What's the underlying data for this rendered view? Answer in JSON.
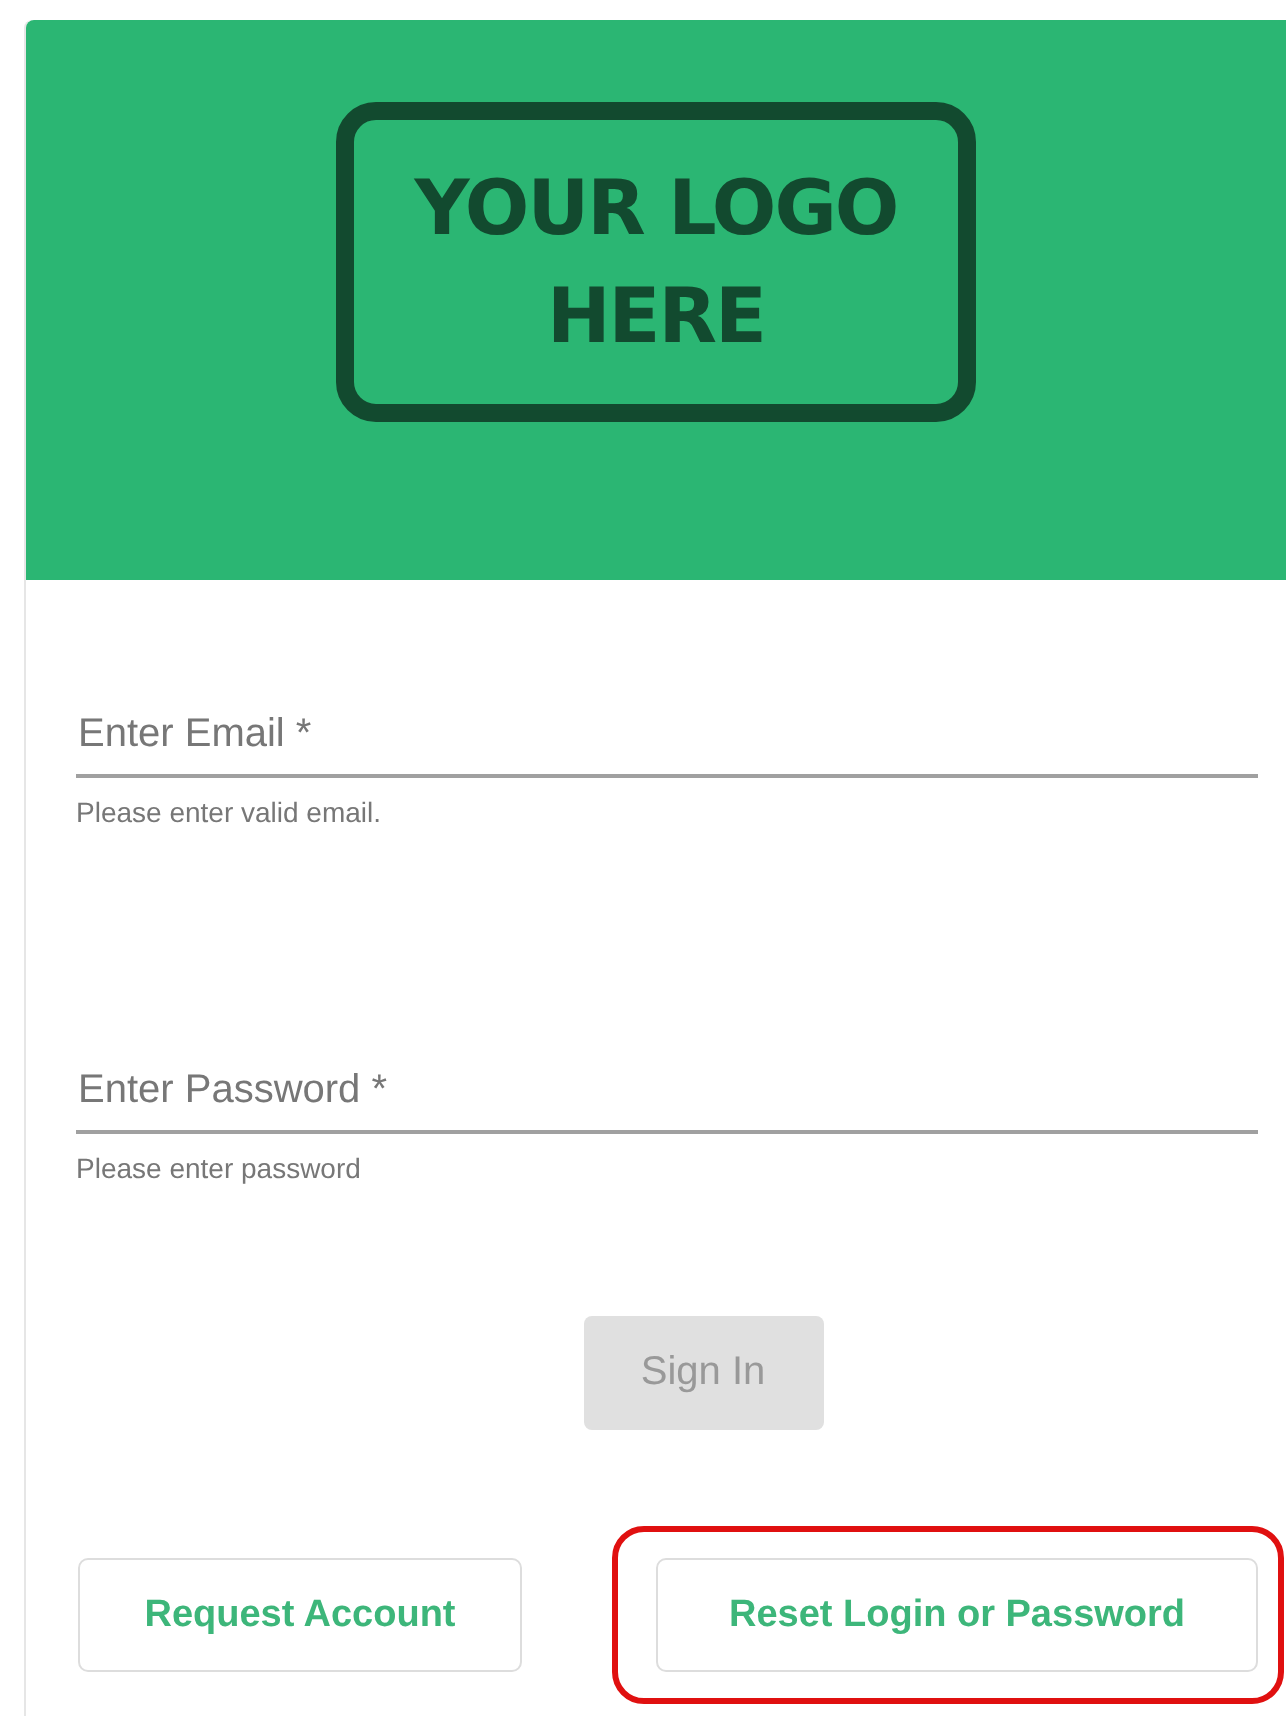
{
  "logo": {
    "lines": [
      "YOUR LOGO",
      "HERE"
    ]
  },
  "fields": [
    {
      "placeholder": "Enter Email *",
      "hint": "Please enter valid email."
    },
    {
      "placeholder": "Enter Password *",
      "hint": "Please enter password"
    }
  ],
  "sign_in": {
    "label": "Sign In",
    "disabled": true
  },
  "buttons": [
    {
      "label": "Request Account",
      "highlighted": false
    },
    {
      "label": "Reset Login or Password",
      "highlighted": true
    }
  ]
}
